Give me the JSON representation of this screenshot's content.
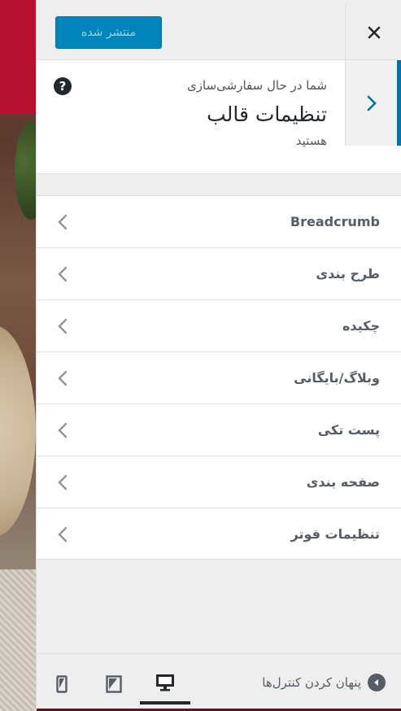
{
  "header": {
    "publish_label": "منتشر شده",
    "close_icon": "close-icon"
  },
  "info": {
    "subtitle": "شما در حال سفارشی‌سازی",
    "title": "تنظیمات قالب",
    "tail": "هستید",
    "help_symbol": "?"
  },
  "sections": [
    {
      "label": "Breadcrumb"
    },
    {
      "label": "طرح بندی"
    },
    {
      "label": "چکیده"
    },
    {
      "label": "وبلاگ/بایگانی"
    },
    {
      "label": "پست تکی"
    },
    {
      "label": "صفحه بندی"
    },
    {
      "label": "تنظیمات فوتر"
    }
  ],
  "footer": {
    "hide_controls_label": "پنهان کردن کنترل‌ها",
    "devices": [
      "desktop",
      "tablet",
      "mobile"
    ],
    "active_device": "desktop"
  },
  "colors": {
    "accent": "#0073aa",
    "publish_button": "#0085ba",
    "text_dark": "#23282d",
    "text_muted": "#555d66"
  }
}
